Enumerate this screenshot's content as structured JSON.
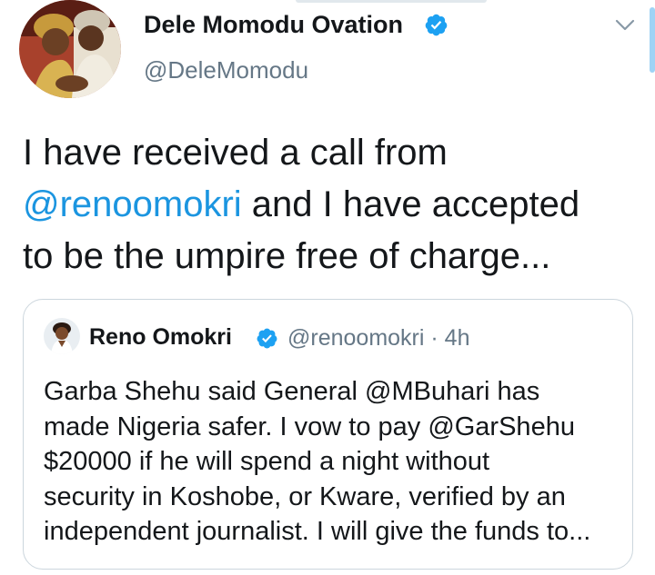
{
  "tweet": {
    "display_name": "Dele Momodu Ovation",
    "handle": "@DeleMomodu",
    "text_line1": "I have received a call from",
    "mention": "@renoomokri",
    "text_line2_rest": " and I have accepted",
    "text_line3": "to be the umpire free of charge..."
  },
  "quoted_tweet": {
    "display_name": "Reno Omokri",
    "handle": "@renoomokri",
    "separator": "·",
    "time": "4h",
    "text_lines": [
      "Garba Shehu said General @MBuhari has",
      "made Nigeria safer. I vow to pay @GarShehu",
      "$20000 if he will spend a night without",
      "security in Koshobe, or Kware, verified by an",
      "independent journalist. I will give the funds to..."
    ]
  },
  "icons": {
    "verified": "verified-badge-icon",
    "chevron": "chevron-down-icon"
  },
  "colors": {
    "accent": "#1da1f2",
    "mention": "#1b95e0",
    "secondary_text": "#657786",
    "border": "#ccd6dd"
  }
}
